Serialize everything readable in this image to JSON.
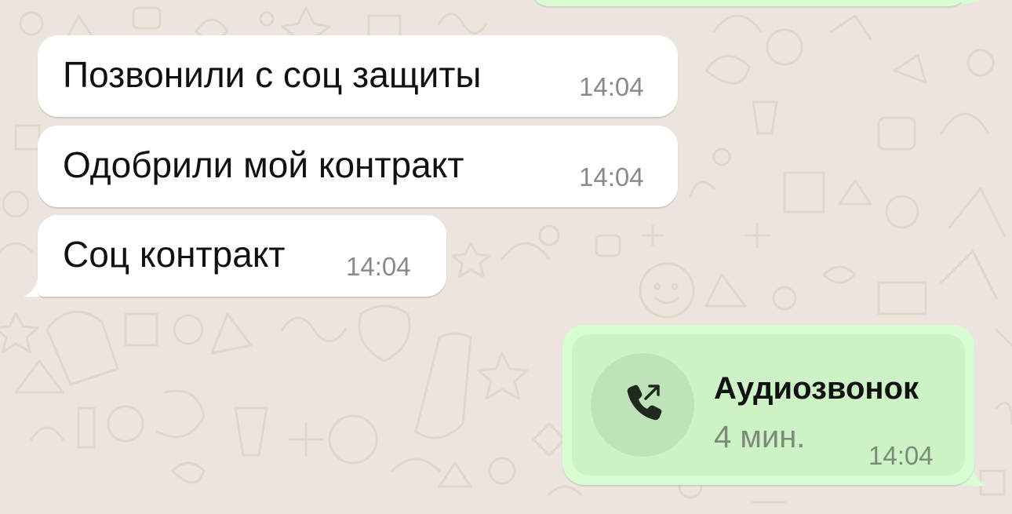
{
  "messages": [
    {
      "text": "Позвонили с соц защиты",
      "time": "14:04"
    },
    {
      "text": "Одобрили мой контракт",
      "time": "14:04"
    },
    {
      "text": "Соц контракт",
      "time": "14:04"
    }
  ],
  "call": {
    "icon": "outgoing-call-icon",
    "title": "Аудиозвонок",
    "duration": "4 мин.",
    "time": "14:04"
  },
  "colors": {
    "chat_background": "#ece5dd",
    "incoming_bubble": "#ffffff",
    "outgoing_bubble": "#d9fdd3",
    "call_card": "#cdf2c6",
    "timestamp": "#8a8a8a"
  }
}
